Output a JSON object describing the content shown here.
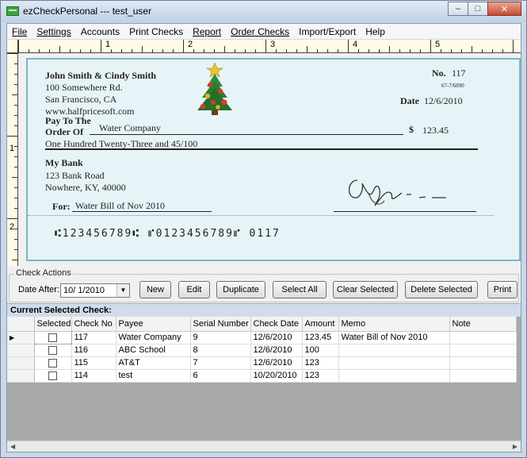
{
  "window": {
    "title": "ezCheckPersonal --- test_user"
  },
  "menu": [
    "File",
    "Settings",
    "Accounts",
    "Print Checks",
    "Report",
    "Order Checks",
    "Import/Export",
    "Help"
  ],
  "ruler": {
    "h_numbers": [
      "1",
      "2",
      "3",
      "4",
      "5"
    ],
    "v_numbers": [
      "1",
      "2"
    ]
  },
  "check": {
    "payer_name": "John Smith & Cindy Smith",
    "payer_address1": "100 Somewhere Rd.",
    "payer_address2": "San Francisco, CA",
    "payer_web": "www.halfpricesoft.com",
    "no_label": "No.",
    "check_no": "117",
    "routing_fraction": "67-7/6890",
    "date_label": "Date",
    "date": "12/6/2010",
    "pay_to_label1": "Pay To The",
    "pay_to_label2": "Order Of",
    "payee": "Water Company",
    "dollar_sign": "$",
    "amount": "123.45",
    "amount_words": "One Hundred Twenty-Three and 45/100",
    "bank_name": "My Bank",
    "bank_address1": "123 Bank Road",
    "bank_address2": "Nowhere, KY, 40000",
    "for_label": "For:",
    "memo": "Water Bill of Nov 2010",
    "micr": "⑆123456789⑆ ⑈0123456789⑈ 0117"
  },
  "actions": {
    "group_label": "Check Actions",
    "date_after_label": "Date After:",
    "date_after_value": "10/ 1/2010",
    "buttons": [
      "New",
      "Edit",
      "Duplicate",
      "Select All",
      "Clear Selected",
      "Delete Selected",
      "Print"
    ]
  },
  "grid": {
    "header": "Current Selected Check:",
    "columns": [
      "Selected",
      "Check No",
      "Payee",
      "Serial Number",
      "Check Date",
      "Amount",
      "Memo",
      "Note"
    ],
    "rows": [
      {
        "check_no": "117",
        "payee": "Water Company",
        "serial": "9",
        "date": "12/6/2010",
        "amount": "123.45",
        "memo": "Water Bill of Nov 2010",
        "note": ""
      },
      {
        "check_no": "116",
        "payee": "ABC School",
        "serial": "8",
        "date": "12/6/2010",
        "amount": "100",
        "memo": "",
        "note": ""
      },
      {
        "check_no": "115",
        "payee": "AT&T",
        "serial": "7",
        "date": "12/6/2010",
        "amount": "123",
        "memo": "",
        "note": ""
      },
      {
        "check_no": "114",
        "payee": "test",
        "serial": "6",
        "date": "10/20/2010",
        "amount": "123",
        "memo": "",
        "note": ""
      }
    ]
  },
  "colors": {
    "check_bg": "#e7f4f7",
    "check_border": "#7ab7c8",
    "ruler_bg": "#fffbe6"
  }
}
